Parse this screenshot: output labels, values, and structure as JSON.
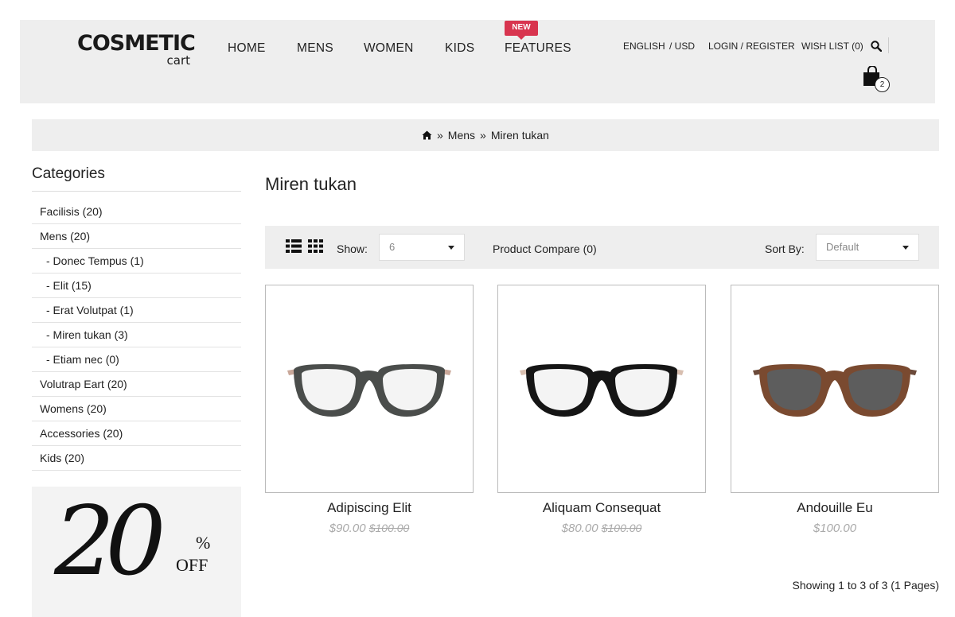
{
  "brand": {
    "name": "COSMETIC",
    "sub": "cart"
  },
  "nav": {
    "items": [
      "HOME",
      "MENS",
      "WOMEN",
      "KIDS",
      "FEATURES"
    ],
    "badge": "NEW"
  },
  "utility": {
    "language": "ENGLISH",
    "currency": "/ USD",
    "login": "LOGIN / REGISTER",
    "wishlist": "WISH LIST (0)",
    "cart_count": "2"
  },
  "breadcrumb": {
    "items": [
      "Mens",
      "Miren tukan"
    ],
    "separator": "»"
  },
  "sidebar": {
    "title": "Categories",
    "categories": [
      "Facilisis (20)",
      "Mens (20)",
      "- Donec Tempus (1)",
      "- Elit (15)",
      "- Erat Volutpat (1)",
      "- Miren tukan (3)",
      "- Etiam nec (0)",
      "Volutrap Eart (20)",
      "Womens (20)",
      "Accessories (20)",
      "Kids (20)"
    ],
    "promo": {
      "big": "20",
      "pct": "%",
      "off": "OFF"
    }
  },
  "page": {
    "title": "Miren tukan"
  },
  "toolbar": {
    "show_label": "Show:",
    "show_value": "6",
    "compare": "Product Compare (0)",
    "sort_label": "Sort By:",
    "sort_value": "Default"
  },
  "products": [
    {
      "name": "Adipiscing Elit",
      "price": "$90.00",
      "old_price": "$100.00",
      "frame": "#4a4d4b",
      "lens": "#f4f4f4",
      "arm": "#c9a89a"
    },
    {
      "name": "Aliquam Consequat",
      "price": "$80.00",
      "old_price": "$100.00",
      "frame": "#151515",
      "lens": "#f4f4f4",
      "arm": "#d8bfb0"
    },
    {
      "name": "Andouille Eu",
      "price": "$100.00",
      "old_price": "",
      "frame": "#7a4a30",
      "lens": "#5d5d5d",
      "arm": "#6b4a3a"
    }
  ],
  "pagination": {
    "text": "Showing 1 to 3 of 3 (1 Pages)"
  },
  "colors": {
    "header_bg": "#eeeeee",
    "badge": "#d8354f",
    "price": "#aaaaaa"
  }
}
